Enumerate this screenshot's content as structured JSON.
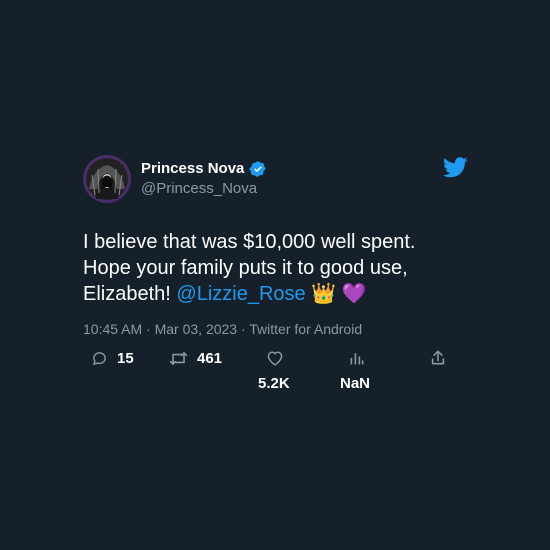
{
  "tweet": {
    "display_name": "Princess Nova",
    "handle": "@Princess_Nova",
    "text_before": "I believe that was $10,000 well spent. Hope your family puts it to good use, Elizabeth! ",
    "mention": "@Lizzie_Rose",
    "emojis": "👑 💜",
    "timestamp": "10:45 AM · Mar 03, 2023 · Twitter for Android"
  },
  "actions": {
    "replies": "15",
    "retweets": "461",
    "likes": "5.2K",
    "views": "NaN"
  },
  "colors": {
    "background": "#15202b",
    "accent": "#1d9bf0",
    "secondary_text": "#8b98a5"
  },
  "icons": [
    "verified-badge-icon",
    "twitter-bird-icon",
    "reply-icon",
    "retweet-icon",
    "like-icon",
    "views-icon",
    "share-icon"
  ]
}
